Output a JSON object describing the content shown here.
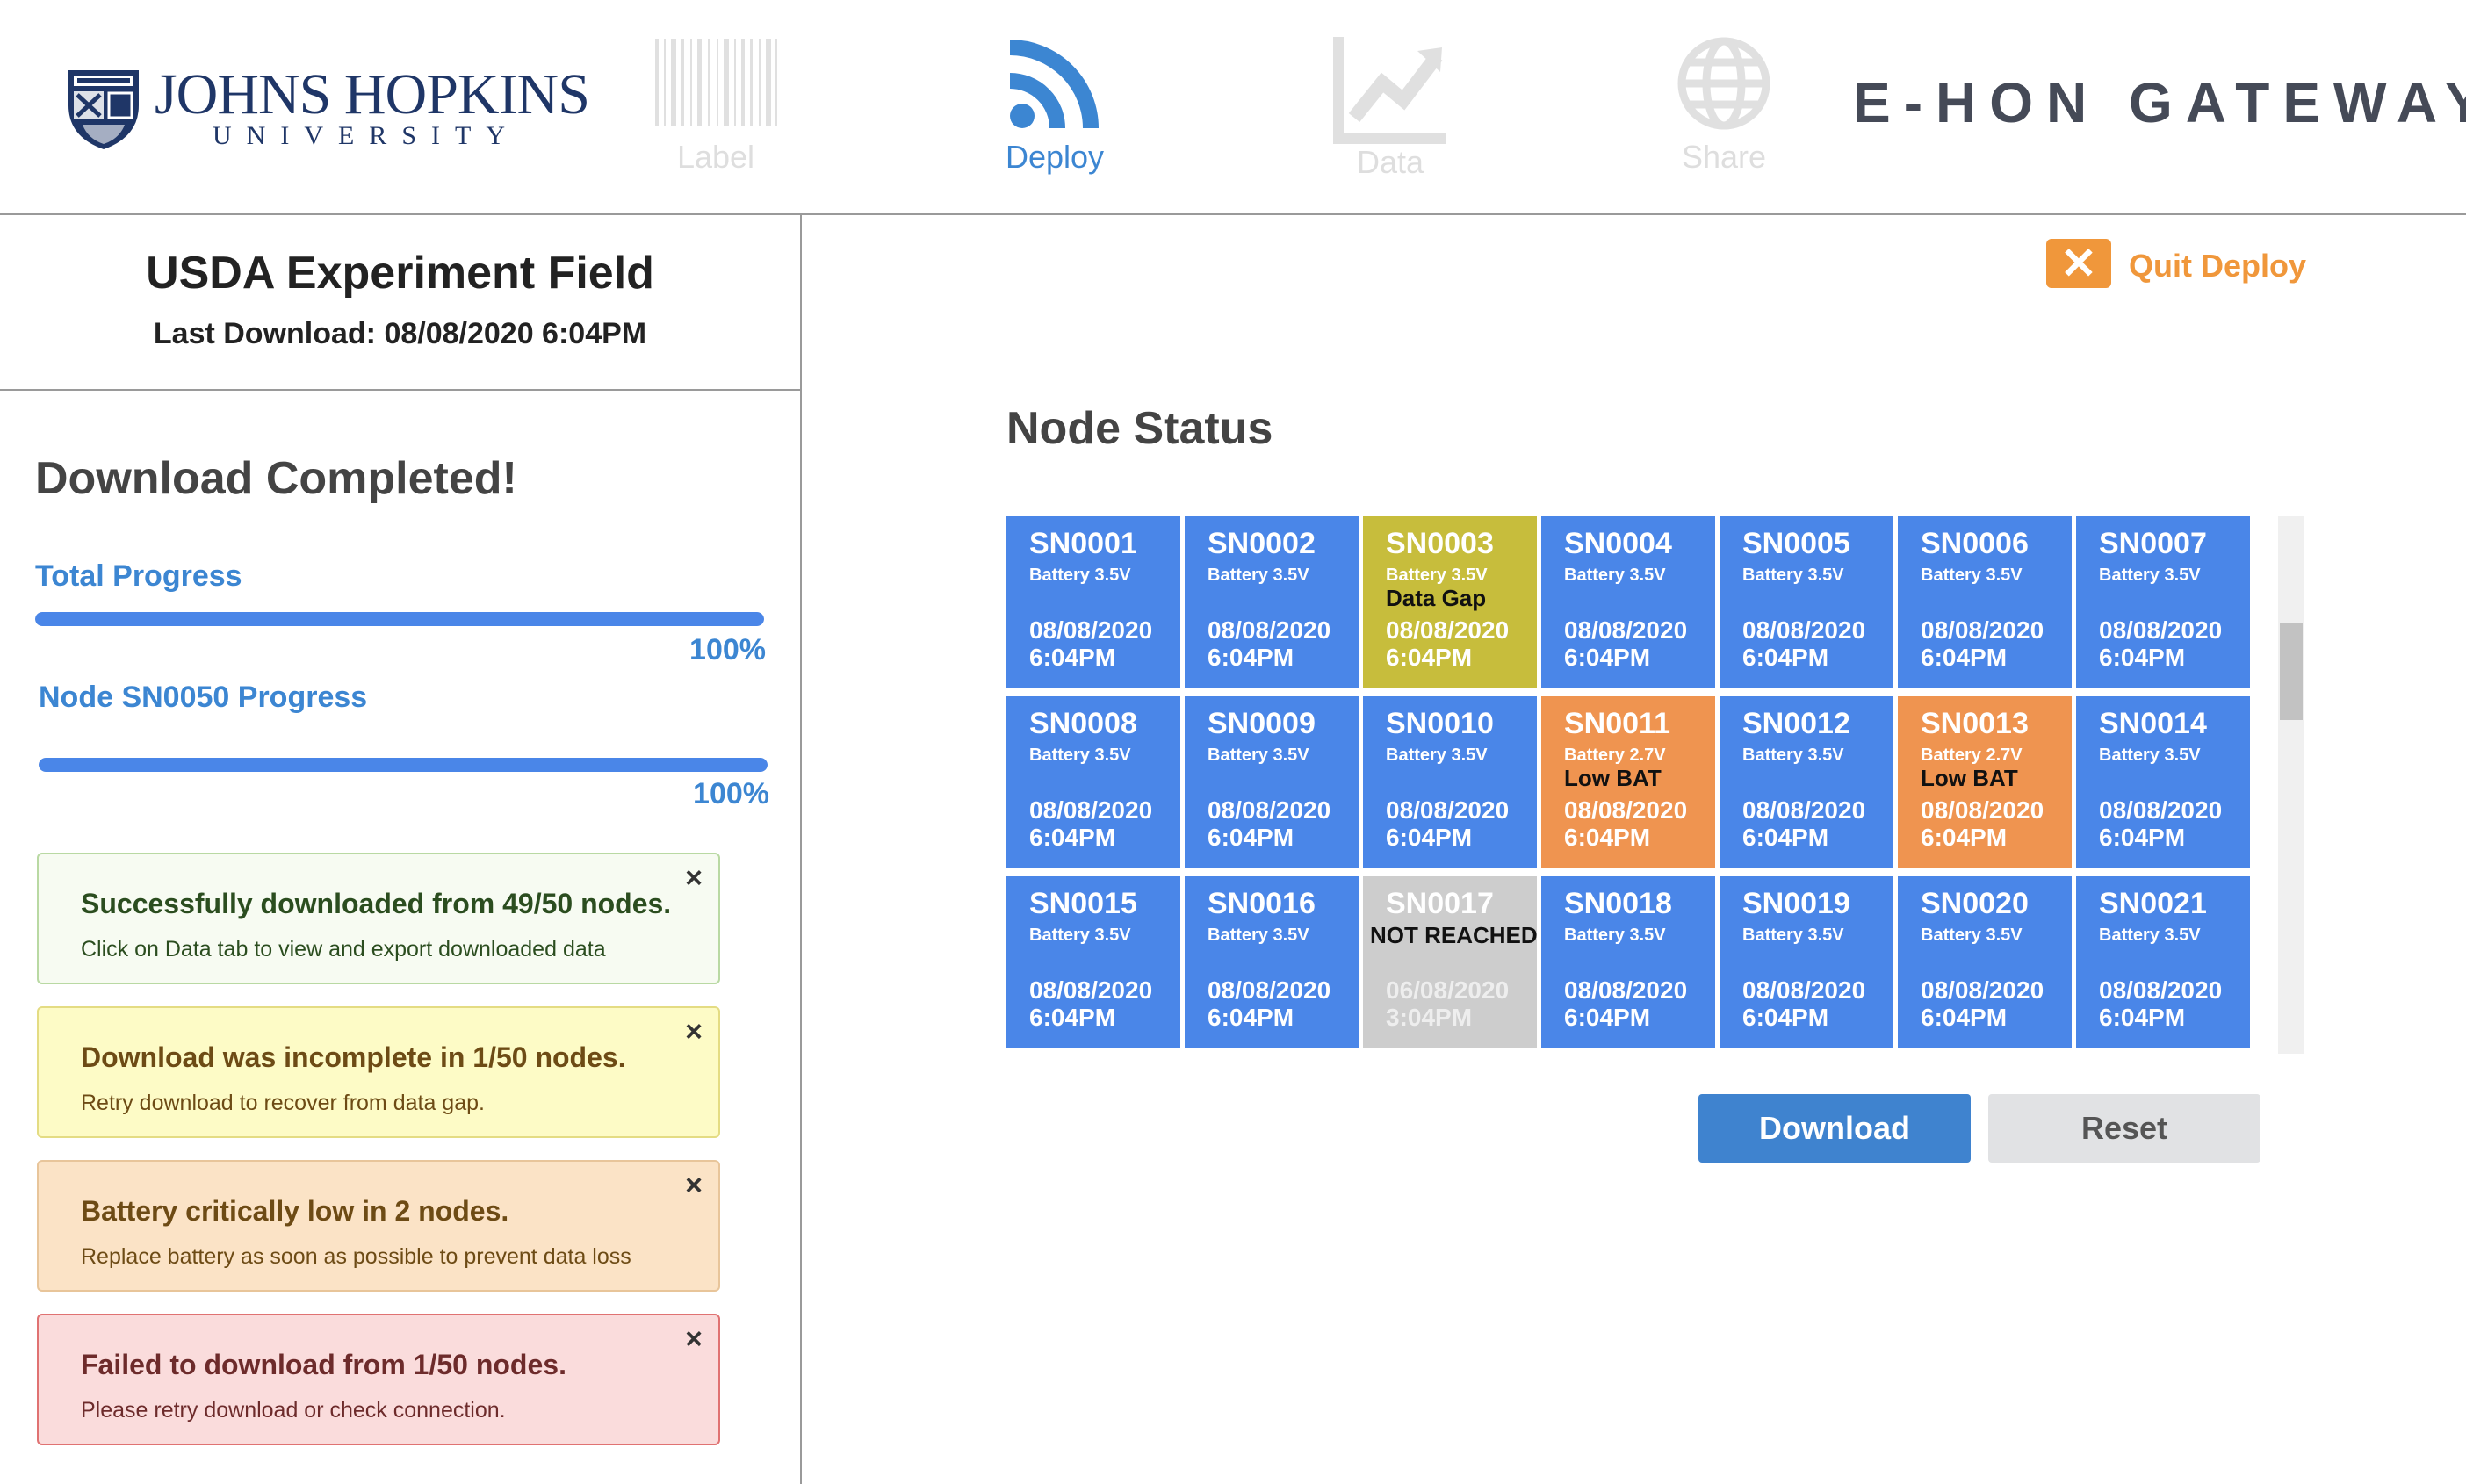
{
  "header": {
    "logo": {
      "name": "JOHNS HOPKINS",
      "sub": "UNIVERSITY"
    },
    "nav": [
      {
        "label": "Label",
        "icon": "barcode-icon",
        "active": false
      },
      {
        "label": "Deploy",
        "icon": "wifi-signal-icon",
        "active": true
      },
      {
        "label": "Data",
        "icon": "chart-icon",
        "active": false
      },
      {
        "label": "Share",
        "icon": "globe-icon",
        "active": false
      }
    ],
    "brand": "E-HON GATEWAY"
  },
  "field": {
    "title": "USDA Experiment Field",
    "last_download": "Last Download: 08/08/2020 6:04PM"
  },
  "download": {
    "status": "Download Completed!",
    "total_label": "Total Progress",
    "total_value": 1.0,
    "total_pct": "100%",
    "node_label": "Node SN0050 Progress",
    "node_value": 1.0,
    "node_pct": "100%"
  },
  "alerts": [
    {
      "type": "success",
      "title": "Successfully downloaded from 49/50 nodes.",
      "body": "Click on Data tab to view and export downloaded data",
      "close": "×"
    },
    {
      "type": "warning",
      "title": "Download was incomplete in 1/50 nodes.",
      "body": "Retry download to recover from data gap.",
      "close": "×"
    },
    {
      "type": "battery",
      "title": "Battery critically low in 2 nodes.",
      "body": "Replace battery as soon as possible to prevent data loss",
      "close": "×"
    },
    {
      "type": "danger",
      "title": "Failed to download from 1/50 nodes.",
      "body": "Please retry download or check connection.",
      "close": "×"
    }
  ],
  "quit": {
    "label": "Quit Deploy",
    "icon": "close-x-icon"
  },
  "node_status": {
    "title": "Node Status",
    "nodes": [
      {
        "id": "SN0001",
        "battery": "Battery 3.5V",
        "flag": "",
        "date": "08/08/2020",
        "time": "6:04PM",
        "status": "ok"
      },
      {
        "id": "SN0002",
        "battery": "Battery 3.5V",
        "flag": "",
        "date": "08/08/2020",
        "time": "6:04PM",
        "status": "ok"
      },
      {
        "id": "SN0003",
        "battery": "Battery 3.5V",
        "flag": "Data Gap",
        "date": "08/08/2020",
        "time": "6:04PM",
        "status": "gap"
      },
      {
        "id": "SN0004",
        "battery": "Battery 3.5V",
        "flag": "",
        "date": "08/08/2020",
        "time": "6:04PM",
        "status": "ok"
      },
      {
        "id": "SN0005",
        "battery": "Battery 3.5V",
        "flag": "",
        "date": "08/08/2020",
        "time": "6:04PM",
        "status": "ok"
      },
      {
        "id": "SN0006",
        "battery": "Battery 3.5V",
        "flag": "",
        "date": "08/08/2020",
        "time": "6:04PM",
        "status": "ok"
      },
      {
        "id": "SN0007",
        "battery": "Battery 3.5V",
        "flag": "",
        "date": "08/08/2020",
        "time": "6:04PM",
        "status": "ok"
      },
      {
        "id": "SN0008",
        "battery": "Battery 3.5V",
        "flag": "",
        "date": "08/08/2020",
        "time": "6:04PM",
        "status": "ok"
      },
      {
        "id": "SN0009",
        "battery": "Battery 3.5V",
        "flag": "",
        "date": "08/08/2020",
        "time": "6:04PM",
        "status": "ok"
      },
      {
        "id": "SN0010",
        "battery": "Battery 3.5V",
        "flag": "",
        "date": "08/08/2020",
        "time": "6:04PM",
        "status": "ok"
      },
      {
        "id": "SN0011",
        "battery": "Battery 2.7V",
        "flag": "Low BAT",
        "date": "08/08/2020",
        "time": "6:04PM",
        "status": "low"
      },
      {
        "id": "SN0012",
        "battery": "Battery 3.5V",
        "flag": "",
        "date": "08/08/2020",
        "time": "6:04PM",
        "status": "ok"
      },
      {
        "id": "SN0013",
        "battery": "Battery 2.7V",
        "flag": "Low BAT",
        "date": "08/08/2020",
        "time": "6:04PM",
        "status": "low"
      },
      {
        "id": "SN0014",
        "battery": "Battery 3.5V",
        "flag": "",
        "date": "08/08/2020",
        "time": "6:04PM",
        "status": "ok"
      },
      {
        "id": "SN0015",
        "battery": "Battery 3.5V",
        "flag": "",
        "date": "08/08/2020",
        "time": "6:04PM",
        "status": "ok"
      },
      {
        "id": "SN0016",
        "battery": "Battery 3.5V",
        "flag": "",
        "date": "08/08/2020",
        "time": "6:04PM",
        "status": "ok"
      },
      {
        "id": "SN0017",
        "battery": "",
        "flag": "NOT REACHED",
        "date": "06/08/2020",
        "time": "3:04PM",
        "status": "unreached"
      },
      {
        "id": "SN0018",
        "battery": "Battery 3.5V",
        "flag": "",
        "date": "08/08/2020",
        "time": "6:04PM",
        "status": "ok"
      },
      {
        "id": "SN0019",
        "battery": "Battery 3.5V",
        "flag": "",
        "date": "08/08/2020",
        "time": "6:04PM",
        "status": "ok"
      },
      {
        "id": "SN0020",
        "battery": "Battery 3.5V",
        "flag": "",
        "date": "08/08/2020",
        "time": "6:04PM",
        "status": "ok"
      },
      {
        "id": "SN0021",
        "battery": "Battery 3.5V",
        "flag": "",
        "date": "08/08/2020",
        "time": "6:04PM",
        "status": "ok"
      }
    ]
  },
  "actions": {
    "download": "Download",
    "reset": "Reset"
  },
  "colors": {
    "accent": "#4a86e8",
    "data_gap": "#c7bd3c",
    "low_battery": "#ef9450",
    "not_reached": "#cdcdcd",
    "quit": "#f0973b"
  }
}
